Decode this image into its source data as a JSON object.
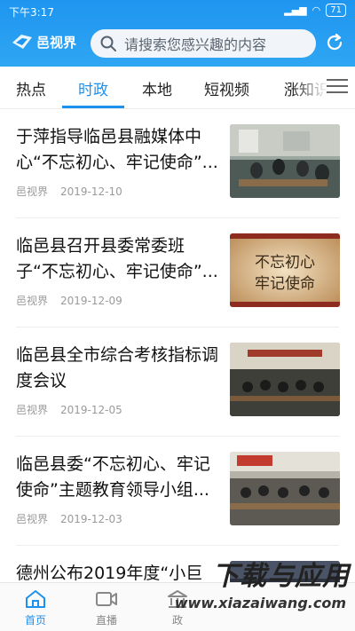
{
  "status": {
    "time": "下午3:17",
    "battery": "71"
  },
  "app": {
    "name": "邑视界"
  },
  "search": {
    "placeholder": "请搜索您感兴趣的内容"
  },
  "tabs": [
    {
      "label": "热点"
    },
    {
      "label": "时政"
    },
    {
      "label": "本地"
    },
    {
      "label": "短视频"
    },
    {
      "label": "涨知识"
    }
  ],
  "articles": [
    {
      "title": "于萍指导临邑县融媒体中心“不忘初心、牢记使命”...",
      "source": "邑视界",
      "date": "2019-12-10"
    },
    {
      "title": "临邑县召开县委常委班子“不忘初心、牢记使命”...",
      "source": "邑视界",
      "date": "2019-12-09",
      "thumb_text": "不忘初心 牢记使命"
    },
    {
      "title": "临邑县全市综合考核指标调度会议",
      "source": "邑视界",
      "date": "2019-12-05"
    },
    {
      "title": "临邑县委“不忘初心、牢记使命”主题教育领导小组...",
      "source": "邑视界",
      "date": "2019-12-03"
    },
    {
      "title": "德州公布2019年度“小巨",
      "source": "",
      "date": ""
    }
  ],
  "bottom_nav": [
    {
      "label": "首页"
    },
    {
      "label": "直播"
    },
    {
      "label": "政"
    }
  ],
  "watermark": {
    "line1": "下载与应用",
    "line2": "www.xiazaiwang.com"
  },
  "colors": {
    "accent": "#1e90ee",
    "header": "#1e95ef"
  }
}
